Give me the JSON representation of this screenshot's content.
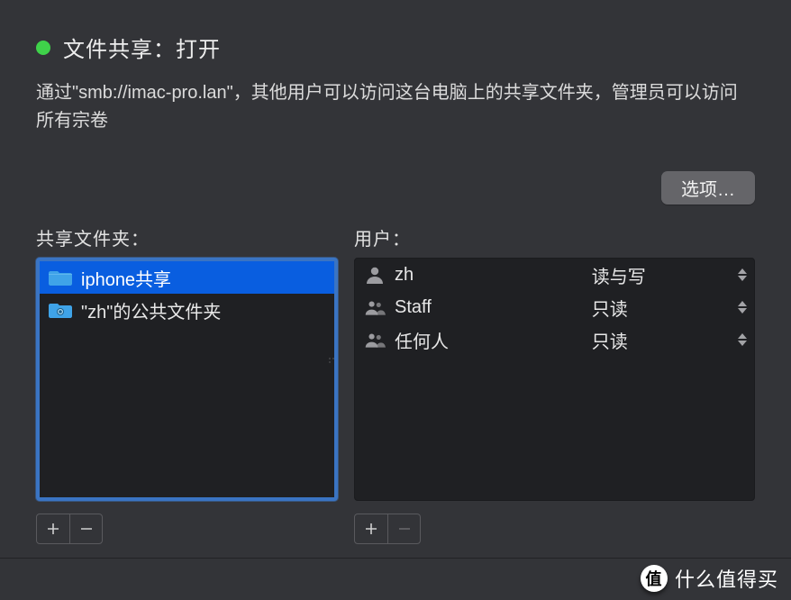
{
  "header": {
    "status_color": "#3fd24a",
    "title": "文件共享：打开"
  },
  "description": "通过\"smb://imac-pro.lan\"，其他用户可以访问这台电脑上的共享文件夹，管理员可以访问所有宗卷",
  "options_button": "选项…",
  "folders": {
    "label": "共享文件夹：",
    "items": [
      {
        "name": "iphone共享",
        "selected": true
      },
      {
        "name": "\"zh\"的公共文件夹",
        "selected": false
      }
    ]
  },
  "users": {
    "label": "用户：",
    "items": [
      {
        "name": "zh",
        "icon": "single",
        "permission": "读与写"
      },
      {
        "name": "Staff",
        "icon": "group",
        "permission": "只读"
      },
      {
        "name": "任何人",
        "icon": "group",
        "permission": "只读"
      }
    ]
  },
  "buttons": {
    "add": "＋",
    "remove": "－"
  },
  "watermark": "什么值得买"
}
